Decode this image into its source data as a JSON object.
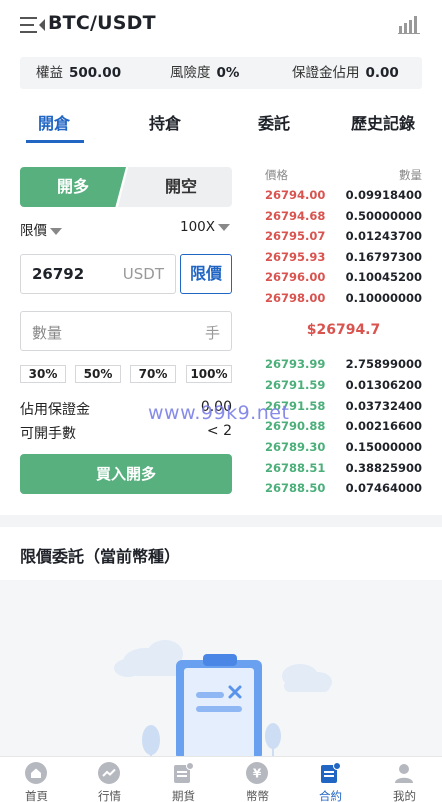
{
  "header": {
    "title": "BTC/USDT",
    "menu_icon": "menu-collapse-icon",
    "chart_icon": "bar-chart-icon"
  },
  "account": {
    "equity_label": "權益",
    "equity_value": "500.00",
    "risk_label": "風險度",
    "risk_value": "0%",
    "margin_label": "保證金佔用",
    "margin_value": "0.00"
  },
  "tabs": [
    {
      "label": "開倉"
    },
    {
      "label": "持倉"
    },
    {
      "label": "委託"
    },
    {
      "label": "歷史記錄"
    }
  ],
  "trade": {
    "open_label": "開多",
    "close_label": "開空",
    "order_type": "限價",
    "leverage": "100X",
    "price_value": "26792",
    "price_unit": "USDT",
    "limit_button": "限價",
    "qty_placeholder": "數量",
    "qty_unit": "手",
    "percents": [
      "30%",
      "50%",
      "70%",
      "100%"
    ],
    "margin_label": "佔用保證金",
    "margin_value": "0.00",
    "lots_label": "可開手數",
    "lots_value": "< 2",
    "buy_button": "買入開多"
  },
  "orderbook": {
    "price_header": "價格",
    "qty_header": "數量",
    "asks": [
      {
        "price": "26794.00",
        "qty": "0.09918400"
      },
      {
        "price": "26794.68",
        "qty": "0.50000000"
      },
      {
        "price": "26795.07",
        "qty": "0.01243700"
      },
      {
        "price": "26795.93",
        "qty": "0.16797300"
      },
      {
        "price": "26796.00",
        "qty": "0.10045200"
      },
      {
        "price": "26798.00",
        "qty": "0.10000000"
      }
    ],
    "mid_price": "$26794.7",
    "bids": [
      {
        "price": "26793.99",
        "qty": "2.75899000"
      },
      {
        "price": "26791.59",
        "qty": "0.01306200"
      },
      {
        "price": "26791.58",
        "qty": "0.03732400"
      },
      {
        "price": "26790.88",
        "qty": "0.00216600"
      },
      {
        "price": "26789.30",
        "qty": "0.15000000"
      },
      {
        "price": "26788.51",
        "qty": "0.38825900"
      },
      {
        "price": "26788.50",
        "qty": "0.07464000"
      }
    ]
  },
  "watermark": "www.99k9.net",
  "orders_section": {
    "title": "限價委託（當前幣種）"
  },
  "colors": {
    "accent": "#2266c4",
    "buy": "#58b07f",
    "ask": "#d9534f",
    "bid": "#4caf7a"
  },
  "bottom_nav": [
    {
      "label": "首頁",
      "icon": "home-icon"
    },
    {
      "label": "行情",
      "icon": "market-trend-icon"
    },
    {
      "label": "期貨",
      "icon": "futures-icon"
    },
    {
      "label": "幣幣",
      "icon": "coin-yen-icon"
    },
    {
      "label": "合約",
      "icon": "contract-icon",
      "active": true
    },
    {
      "label": "我的",
      "icon": "profile-icon"
    }
  ]
}
